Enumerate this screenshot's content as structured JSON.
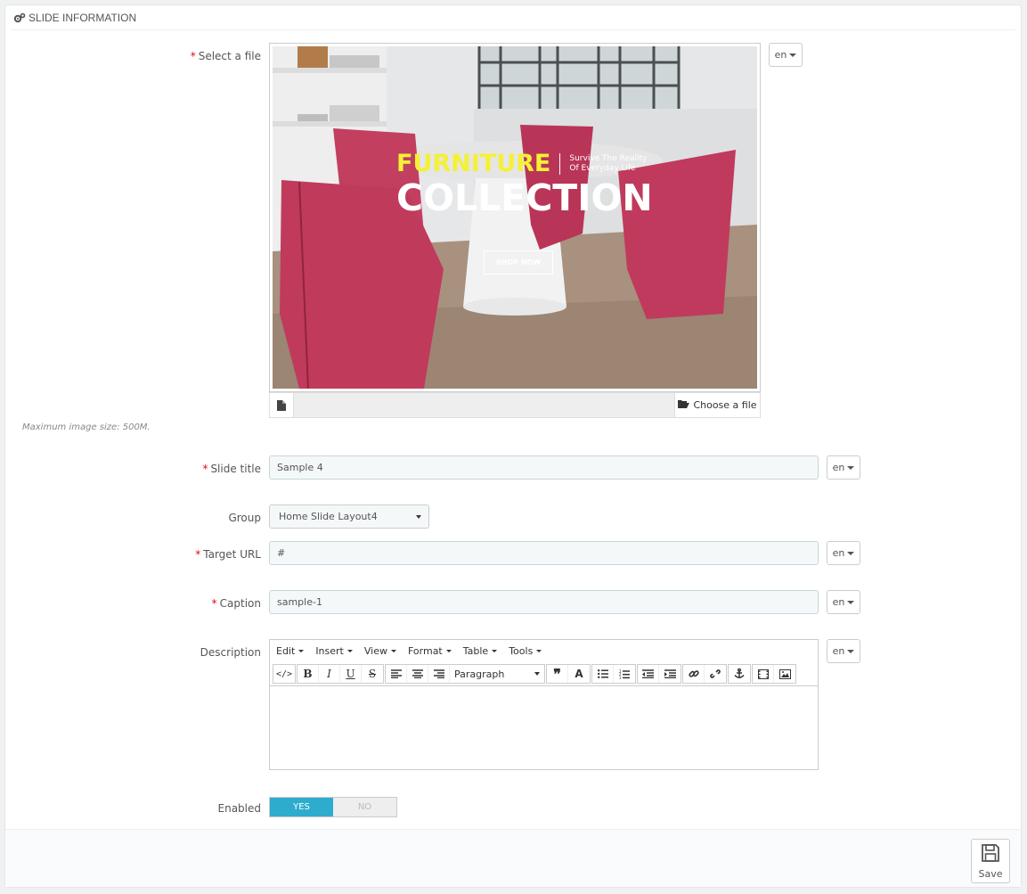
{
  "panel": {
    "title": "SLIDE INFORMATION"
  },
  "fields": {
    "file": {
      "label": "Select a file",
      "lang": "en",
      "choose_label": "Choose a file",
      "hint": "Maximum image size: 500M."
    },
    "slide_title": {
      "label": "Slide title",
      "value": "Sample 4",
      "lang": "en"
    },
    "group": {
      "label": "Group",
      "value": "Home Slide Layout4"
    },
    "target_url": {
      "label": "Target URL",
      "value": "#",
      "lang": "en"
    },
    "caption": {
      "label": "Caption",
      "value": "sample-1",
      "lang": "en"
    },
    "description": {
      "label": "Description",
      "lang": "en",
      "menu": [
        "Edit",
        "Insert",
        "View",
        "Format",
        "Table",
        "Tools"
      ],
      "block_format": "Paragraph"
    },
    "enabled": {
      "label": "Enabled",
      "yes": "YES",
      "no": "NO",
      "value": "YES"
    }
  },
  "slide_image": {
    "headline_word1": "FURNITURE",
    "headline_word2": "COLLECTION",
    "tagline_line1": "Survive The Reality",
    "tagline_line2": "Of Everyday Life",
    "cta": "SHOP NOW",
    "accent_color": "#f4f136",
    "chair_color": "#c0395c"
  },
  "footer": {
    "save_label": "Save"
  },
  "colors": {
    "primary": "#2eacce",
    "required": "#e00000"
  }
}
